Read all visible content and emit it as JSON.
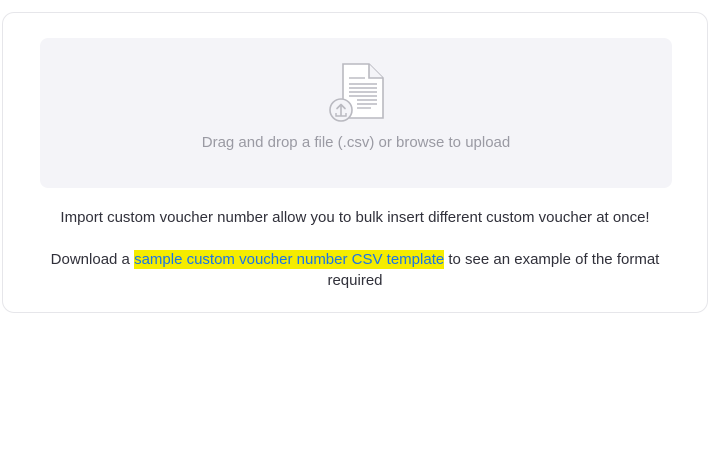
{
  "upload": {
    "drop_text": "Drag and drop a file (.csv) or browse to upload",
    "icon": "file-upload-icon"
  },
  "info": {
    "import_text": "Import custom voucher number allow you to bulk insert different custom voucher at once!",
    "download_prefix": "Download a ",
    "template_link": "sample custom voucher number CSV template",
    "download_suffix": " to see an example of the format required"
  },
  "colors": {
    "link": "#1a73e8",
    "highlight": "#f5ec00",
    "dropzone_bg": "#f4f4f8"
  }
}
